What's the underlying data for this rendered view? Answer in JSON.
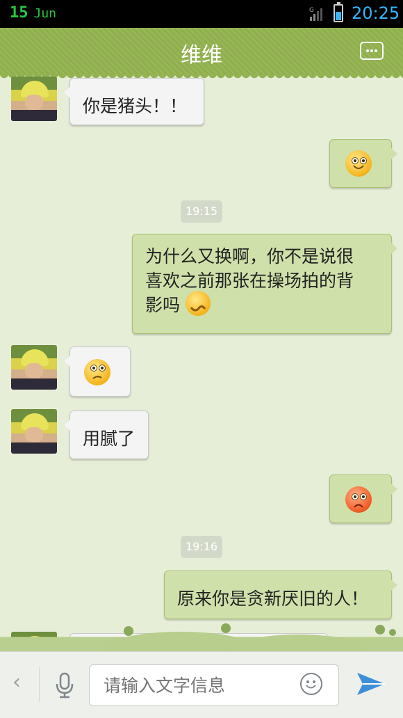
{
  "status": {
    "day": "15",
    "month": "Jun",
    "time": "20:25"
  },
  "header": {
    "title": "维维"
  },
  "messages": [
    {
      "side": "in",
      "text": "你是猪头！！"
    },
    {
      "side": "out",
      "emoji": "smile-emoji"
    },
    {
      "type": "time",
      "text": "19:15"
    },
    {
      "side": "out",
      "text_line1": "为什么又换啊，你不是说很",
      "text_line2": "喜欢之前那张在操场拍的背",
      "text_line3": "影吗",
      "emoji": "shy-emoji"
    },
    {
      "side": "in",
      "emoji": "thinking-emoji"
    },
    {
      "side": "in",
      "text": "用腻了"
    },
    {
      "side": "out",
      "emoji": "angry-emoji"
    },
    {
      "type": "time",
      "text": "19:16"
    },
    {
      "side": "out",
      "text": "原来你是贪新厌旧的人！"
    }
  ],
  "input": {
    "placeholder": "请输入文字信息"
  },
  "colors": {
    "accent": "#93b252",
    "time": "#35b6ff",
    "date": "#27c93f"
  }
}
